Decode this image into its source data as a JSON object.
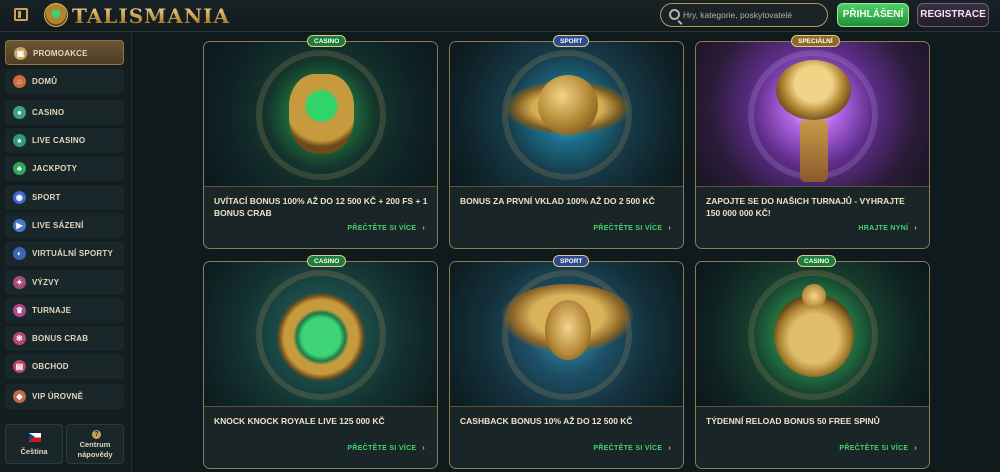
{
  "header": {
    "brand": "TALISMANIA",
    "search_placeholder": "Hry, kategorie, poskytovatelé",
    "login_label": "PŘIHLÁŠENÍ",
    "register_label": "REGISTRACE"
  },
  "sidebar": {
    "items": [
      {
        "label": "PROMOAKCE",
        "icon": "gift-icon",
        "color": "#c9a35a"
      },
      {
        "label": "DOMŮ",
        "icon": "home-icon",
        "color": "#d06a3a"
      },
      {
        "label": "CASINO",
        "icon": "casino-chip-icon",
        "color": "#3aa57d"
      },
      {
        "label": "LIVE CASINO",
        "icon": "live-casino-icon",
        "color": "#2f9b7b"
      },
      {
        "label": "JACKPOTY",
        "icon": "clover-icon",
        "color": "#2fa85a"
      },
      {
        "label": "SPORT",
        "icon": "soccer-ball-icon",
        "color": "#3a6ad0"
      },
      {
        "label": "LIVE SÁZENÍ",
        "icon": "live-betting-icon",
        "color": "#4a78c8"
      },
      {
        "label": "VIRTUÁLNÍ SPORTY",
        "icon": "virtual-sports-icon",
        "color": "#3f63b5"
      },
      {
        "label": "VÝZVY",
        "icon": "challenge-icon",
        "color": "#a54c7d"
      },
      {
        "label": "TURNAJE",
        "icon": "trophy-icon",
        "color": "#b04a86"
      },
      {
        "label": "BONUS CRAB",
        "icon": "crab-icon",
        "color": "#b84a6c"
      },
      {
        "label": "OBCHOD",
        "icon": "shop-icon",
        "color": "#b2465f"
      },
      {
        "label": "VIP ÚROVNĚ",
        "icon": "diamond-icon",
        "color": "#c26a4a"
      }
    ],
    "language_label": "Čeština",
    "help_label_1": "Centrum",
    "help_label_2": "nápovědy"
  },
  "promotions": [
    {
      "badge": "CASINO",
      "title": "UVÍTACÍ BONUS 100% AŽ DO 12 500 KČ + 200 FS + 1 BONUS CRAB",
      "link": "PŘEČTĚTE SI VÍCE",
      "theme": "#2fbf5a"
    },
    {
      "badge": "SPORT",
      "title": "BONUS ZA PRVNÍ VKLAD 100% AŽ DO 2 500 KČ",
      "link": "PŘEČTĚTE SI VÍCE",
      "theme": "#2aa6c8"
    },
    {
      "badge": "SPECIÁLNÍ",
      "title": "ZAPOJTE SE DO NAŠICH TURNAJŮ - VYHRAJTE 150 000 000 KČ!",
      "link": "HRAJTE NYNÍ",
      "theme": "#9a4fd0"
    },
    {
      "badge": "CASINO",
      "title": "KNOCK KNOCK ROYALE LIVE 125 000 KČ",
      "link": "PŘEČTĚTE SI VÍCE",
      "theme": "#2fbf5a"
    },
    {
      "badge": "SPORT",
      "title": "CASHBACK BONUS 10% AŽ DO 12 500 KČ",
      "link": "PŘEČTĚTE SI VÍCE",
      "theme": "#2aa6c8"
    },
    {
      "badge": "CASINO",
      "title": "TÝDENNÍ RELOAD BONUS 50 FREE SPINŮ",
      "link": "PŘEČTĚTE SI VÍCE",
      "theme": "#2fbf5a"
    }
  ]
}
